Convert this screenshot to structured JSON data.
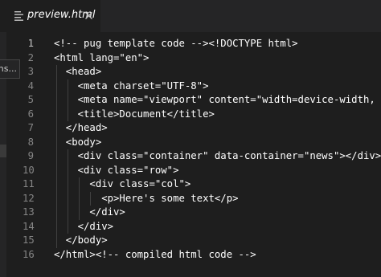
{
  "tab": {
    "label": "preview.html",
    "file_icon": "lines-file-icon",
    "close_icon": "close-icon"
  },
  "hover_tooltip": "ons...",
  "editor": {
    "lines": [
      {
        "n": "1",
        "text": "<!-- pug template code --><!DOCTYPE html>"
      },
      {
        "n": "2",
        "text": "<html lang=\"en\">"
      },
      {
        "n": "3",
        "text": "  <head>"
      },
      {
        "n": "4",
        "text": "    <meta charset=\"UTF-8\">"
      },
      {
        "n": "5",
        "text": "    <meta name=\"viewport\" content=\"width=device-width, ini"
      },
      {
        "n": "6",
        "text": "    <title>Document</title>"
      },
      {
        "n": "7",
        "text": "  </head>"
      },
      {
        "n": "8",
        "text": "  <body>"
      },
      {
        "n": "9",
        "text": "    <div class=\"container\" data-container=\"news\"></div>"
      },
      {
        "n": "10",
        "text": "    <div class=\"row\">"
      },
      {
        "n": "11",
        "text": "      <div class=\"col\">"
      },
      {
        "n": "12",
        "text": "        <p>Here's some text</p>"
      },
      {
        "n": "13",
        "text": "      </div>"
      },
      {
        "n": "14",
        "text": "    </div>"
      },
      {
        "n": "15",
        "text": "  </body>"
      },
      {
        "n": "16",
        "text": "</html><!-- compiled html code -->"
      }
    ]
  },
  "colors": {
    "editor_bg": "#1e1e1e",
    "tabbar_bg": "#252526",
    "line_number": "#858585",
    "active_line_number": "#c6c6c6",
    "code_text": "#ffffff"
  }
}
